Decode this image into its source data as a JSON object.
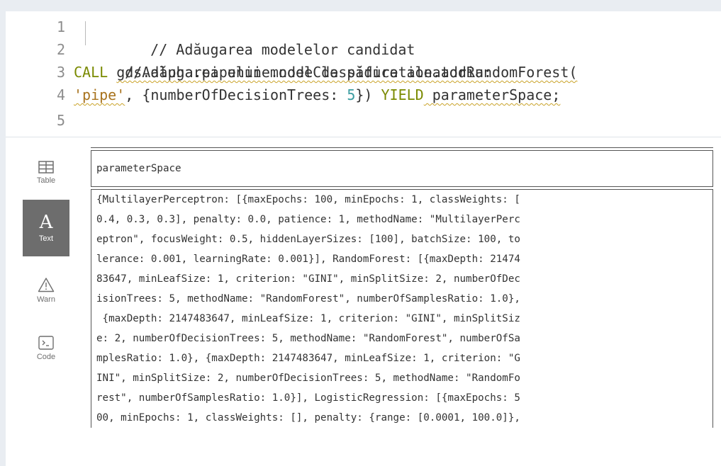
{
  "editor": {
    "line_numbers": [
      "1",
      "2",
      "3",
      "4",
      "5"
    ],
    "line1": {
      "text": "// Adăugarea modelelor candidat"
    },
    "line2": {
      "text": "//Adăugarea unui model de pădure aleatoriu:"
    },
    "line3": {
      "call": "CALL",
      "proc": "gds.alpha.pipeline.nodeClassification.addRandomForest("
    },
    "line4": {
      "str": "'pipe'",
      "comma": ", ",
      "map_open": "{numberOfDecisionTrees: ",
      "num": "5",
      "map_close": "}) ",
      "yield": "YIELD",
      "rest": " parameterSpace;"
    }
  },
  "sidebar": {
    "table_label": "Table",
    "text_label": "Text",
    "text_glyph": "A",
    "warn_label": "Warn",
    "code_label": "Code"
  },
  "result": {
    "header": "parameterSpace",
    "rows": [
      "{MultilayerPerceptron: [{maxEpochs: 100, minEpochs: 1, classWeights: [",
      "0.4, 0.3, 0.3], penalty: 0.0, patience: 1, methodName: \"MultilayerPerc",
      "eptron\", focusWeight: 0.5, hiddenLayerSizes: [100], batchSize: 100, to",
      "lerance: 0.001, learningRate: 0.001}], RandomForest: [{maxDepth: 21474",
      "83647, minLeafSize: 1, criterion: \"GINI\", minSplitSize: 2, numberOfDec",
      "isionTrees: 5, methodName: \"RandomForest\", numberOfSamplesRatio: 1.0},",
      " {maxDepth: 2147483647, minLeafSize: 1, criterion: \"GINI\", minSplitSiz",
      "e: 2, numberOfDecisionTrees: 5, methodName: \"RandomForest\", numberOfSa",
      "mplesRatio: 1.0}, {maxDepth: 2147483647, minLeafSize: 1, criterion: \"G",
      "INI\", minSplitSize: 2, numberOfDecisionTrees: 5, methodName: \"RandomFo",
      "rest\", numberOfSamplesRatio: 1.0}], LogisticRegression: [{maxEpochs: 5",
      "00, minEpochs: 1, classWeights: [], penalty: {range: [0.0001, 100.0]},"
    ]
  }
}
